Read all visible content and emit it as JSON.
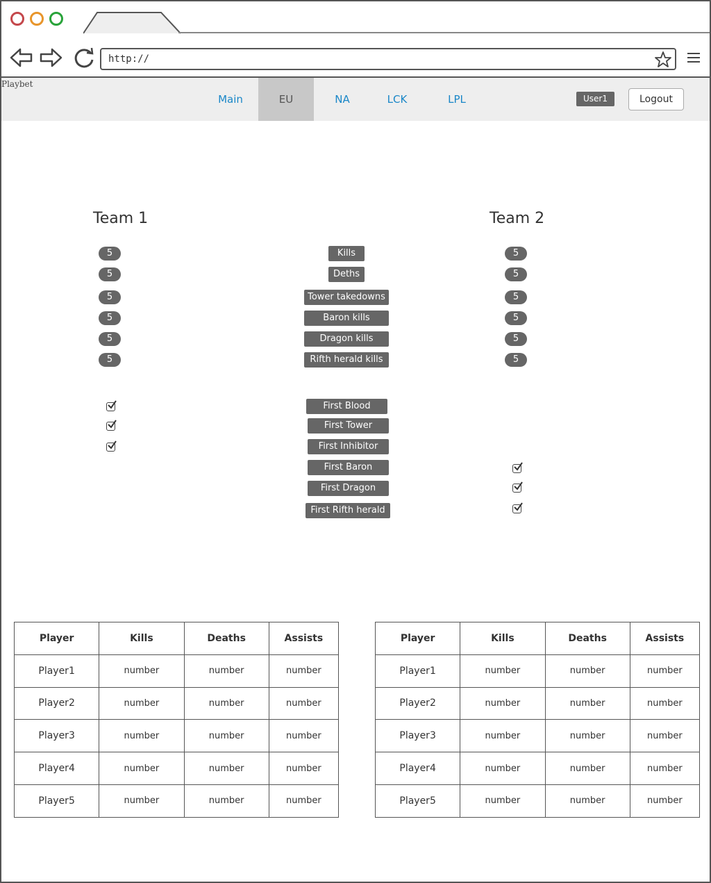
{
  "browser": {
    "address": "http://",
    "menu_icon": "hamburger-icon"
  },
  "nav": {
    "logo": "Playbet",
    "items": [
      {
        "label": "Main",
        "active": false
      },
      {
        "label": "EU",
        "active": true
      },
      {
        "label": "NA",
        "active": false
      },
      {
        "label": "LCK",
        "active": false
      },
      {
        "label": "LPL",
        "active": false
      }
    ],
    "user": "User1",
    "logout": "Logout"
  },
  "teams": {
    "team1": "Team 1",
    "team2": "Team 2"
  },
  "stats": [
    {
      "label": "Kills",
      "team1": "5",
      "team2": "5"
    },
    {
      "label": "Deths",
      "team1": "5",
      "team2": "5"
    },
    {
      "label": "Tower takedowns",
      "team1": "5",
      "team2": "5"
    },
    {
      "label": "Baron kills",
      "team1": "5",
      "team2": "5"
    },
    {
      "label": "Dragon kills",
      "team1": "5",
      "team2": "5"
    },
    {
      "label": "Rifth herald kills",
      "team1": "5",
      "team2": "5"
    }
  ],
  "firsts": [
    {
      "label": "First Blood",
      "team1": true,
      "team2": false
    },
    {
      "label": "First Tower",
      "team1": true,
      "team2": false
    },
    {
      "label": "First Inhibitor",
      "team1": true,
      "team2": false
    },
    {
      "label": "First Baron",
      "team1": false,
      "team2": true
    },
    {
      "label": "First Dragon",
      "team1": false,
      "team2": true
    },
    {
      "label": "First Rifth herald",
      "team1": false,
      "team2": true
    }
  ],
  "table": {
    "headers": [
      "Player",
      "Kills",
      "Deaths",
      "Assists"
    ],
    "team1_rows": [
      [
        "Player1",
        "number",
        "number",
        "number"
      ],
      [
        "Player2",
        "number",
        "number",
        "number"
      ],
      [
        "Player3",
        "number",
        "number",
        "number"
      ],
      [
        "Player4",
        "number",
        "number",
        "number"
      ],
      [
        "Player5",
        "number",
        "number",
        "number"
      ]
    ],
    "team2_rows": [
      [
        "Player1",
        "number",
        "number",
        "number"
      ],
      [
        "Player2",
        "number",
        "number",
        "number"
      ],
      [
        "Player3",
        "number",
        "number",
        "number"
      ],
      [
        "Player4",
        "number",
        "number",
        "number"
      ],
      [
        "Player5",
        "number",
        "number",
        "number"
      ]
    ]
  }
}
